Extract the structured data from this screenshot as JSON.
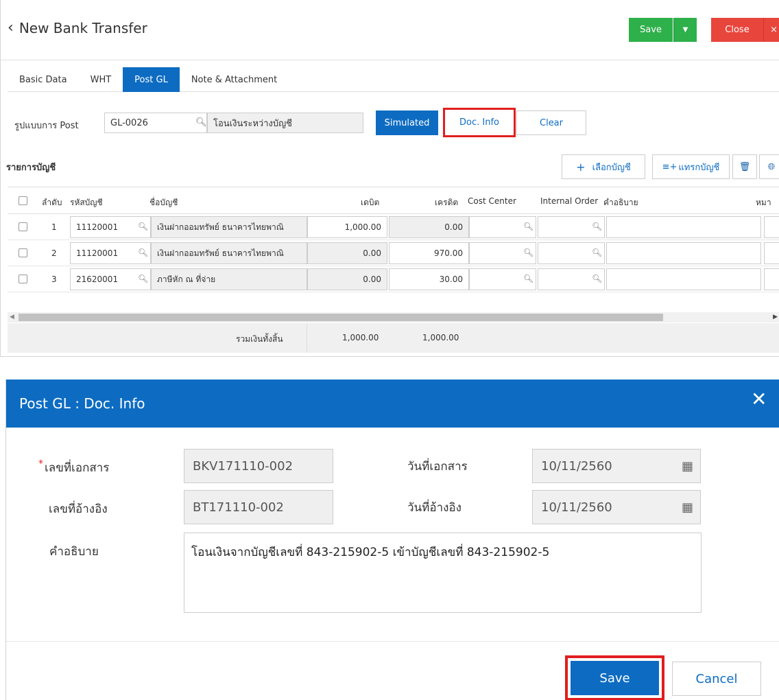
{
  "header": {
    "title": "New Bank Transfer",
    "save_label": "Save",
    "close_label": "Close",
    "close_x": "×"
  },
  "tabs": [
    {
      "label": "Basic Data",
      "active": false
    },
    {
      "label": "WHT",
      "active": false
    },
    {
      "label": "Post GL",
      "active": true
    },
    {
      "label": "Note & Attachment",
      "active": false
    }
  ],
  "post_format": {
    "label": "รูปแบบการ Post",
    "code": "GL-0026",
    "name": "โอนเงินระหว่างบัญชี"
  },
  "actions": {
    "simulated": "Simulated",
    "doc_info": "Doc. Info",
    "clear": "Clear"
  },
  "accounts": {
    "title": "รายการบัญชี",
    "select_account": "เลือกบัญชี",
    "insert_account": "แทรกบัญชี"
  },
  "columns": {
    "seq": "ลำดับ",
    "code": "รหัสบัญชี",
    "name": "ชื่อบัญชี",
    "debit": "เดบิต",
    "credit": "เครดิต",
    "cost_center": "Cost Center",
    "internal_order": "Internal Order",
    "description": "คำอธิบาย",
    "note": "หมา"
  },
  "rows": [
    {
      "seq": "1",
      "code": "11120001",
      "name": "เงินฝากออมทรัพย์ ธนาคารไทยพาณิ",
      "debit": "1,000.00",
      "credit": "0.00"
    },
    {
      "seq": "2",
      "code": "11120001",
      "name": "เงินฝากออมทรัพย์ ธนาคารไทยพาณิ",
      "debit": "0.00",
      "credit": "970.00"
    },
    {
      "seq": "3",
      "code": "21620001",
      "name": "ภาษีหัก ณ ที่จ่าย",
      "debit": "0.00",
      "credit": "30.00"
    }
  ],
  "totals": {
    "label": "รวมเงินทั้งสิ้น",
    "debit": "1,000.00",
    "credit": "1,000.00"
  },
  "dialog": {
    "title": "Post GL : Doc. Info",
    "doc_no_label": "เลขที่เอกสาร",
    "doc_no": "BKV171110-002",
    "doc_date_label": "วันที่เอกสาร",
    "doc_date": "10/11/2560",
    "ref_no_label": "เลขที่อ้างอิง",
    "ref_no": "BT171110-002",
    "ref_date_label": "วันที่อ้างอิง",
    "ref_date": "10/11/2560",
    "desc_label": "คำอธิบาย",
    "desc": "โอนเงินจากบัญชีเลขที่ 843-215902-5 เข้าบัญชีเลขที่ 843-215902-5",
    "save_label": "Save",
    "cancel_label": "Cancel"
  },
  "colors": {
    "primary": "#0d6cc2",
    "save_green": "#2eb04a",
    "close_red": "#e8453c",
    "highlight_red": "#e01e1e"
  }
}
